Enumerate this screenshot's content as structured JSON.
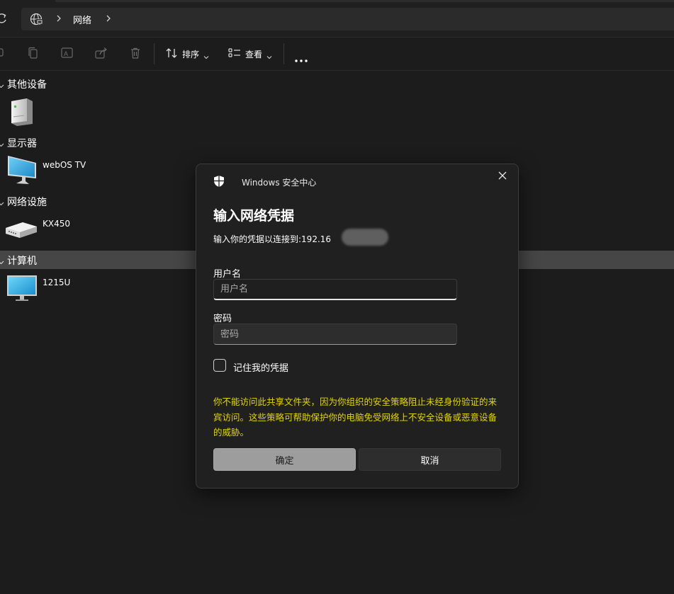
{
  "addressbar": {
    "refresh_icon": "refresh-icon",
    "location_icon": "network-globe-icon",
    "breadcrumb": [
      "网络"
    ]
  },
  "toolbar": {
    "sort_label": "排序",
    "view_label": "查看",
    "icons": [
      "rename-icon",
      "copy-icon",
      "ai-rename-icon",
      "share-icon",
      "delete-icon",
      "sort-icon",
      "view-icon",
      "more-icon"
    ]
  },
  "groups": [
    {
      "title": "其他设备",
      "selected": false,
      "items": [
        {
          "name": "",
          "icon": "server-icon"
        }
      ]
    },
    {
      "title": "显示器",
      "selected": false,
      "items": [
        {
          "name": "webOS TV",
          "icon": "monitor-icon"
        }
      ]
    },
    {
      "title": "网络设施",
      "selected": false,
      "items": [
        {
          "name": "KX450",
          "icon": "router-icon"
        }
      ]
    },
    {
      "title": "计算机",
      "selected": true,
      "items": [
        {
          "name": "1215U",
          "icon": "computer-icon"
        }
      ]
    }
  ],
  "dialog": {
    "app_name": "Windows 安全中心",
    "title": "输入网络凭据",
    "subtitle": "输入你的凭据以连接到:192.16",
    "username_label": "用户名",
    "username_placeholder": "用户名",
    "password_label": "密码",
    "password_placeholder": "密码",
    "remember_label": "记住我的凭据",
    "remember_checked": false,
    "warning": "你不能访问此共享文件夹，因为你组织的安全策略阻止未经身份验证的来宾访问。这些策略可帮助保护你的电脑免受网络上不安全设备或恶意设备的威胁。",
    "ok_label": "确定",
    "cancel_label": "取消",
    "warning_color": "#e4d600"
  }
}
